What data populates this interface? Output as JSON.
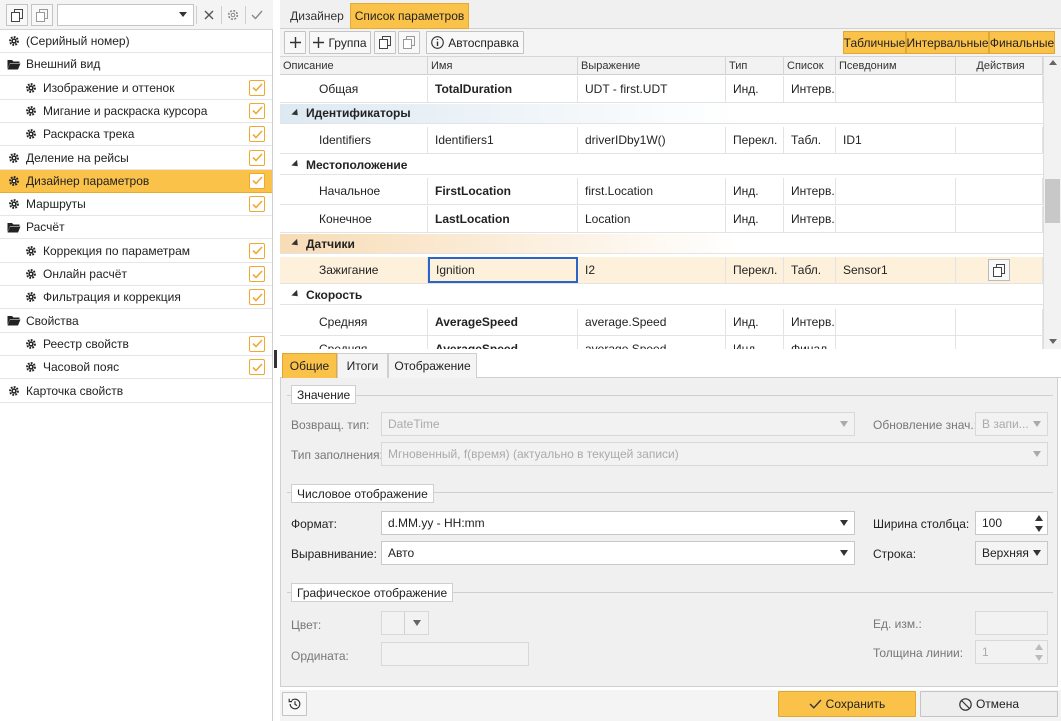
{
  "left_panel": {
    "tree": [
      {
        "label": "(Серийный номер)",
        "icon": "gear-icon",
        "level": 0,
        "checked": false
      },
      {
        "label": "Внешний вид",
        "icon": "folder-open-icon",
        "level": 0,
        "checked": false
      },
      {
        "label": "Изображение и оттенок",
        "icon": "gear-icon",
        "level": 1,
        "checked": true
      },
      {
        "label": "Мигание и раскраска курсора",
        "icon": "gear-icon",
        "level": 1,
        "checked": true
      },
      {
        "label": "Раскраска трека",
        "icon": "gear-icon",
        "level": 1,
        "checked": true
      },
      {
        "label": "Деление на рейсы",
        "icon": "gear-icon",
        "level": 0,
        "checked": true
      },
      {
        "label": "Дизайнер параметров",
        "icon": "gear-icon",
        "level": 0,
        "checked": true,
        "selected": true
      },
      {
        "label": "Маршруты",
        "icon": "gear-icon",
        "level": 0,
        "checked": true
      },
      {
        "label": "Расчёт",
        "icon": "folder-open-icon",
        "level": 0,
        "checked": false
      },
      {
        "label": "Коррекция по параметрам",
        "icon": "gear-icon",
        "level": 1,
        "checked": true
      },
      {
        "label": "Онлайн расчёт",
        "icon": "gear-icon",
        "level": 1,
        "checked": true
      },
      {
        "label": "Фильтрация и коррекция",
        "icon": "gear-icon",
        "level": 1,
        "checked": true
      },
      {
        "label": "Свойства",
        "icon": "folder-open-icon",
        "level": 0,
        "checked": false
      },
      {
        "label": "Реестр свойств",
        "icon": "gear-icon",
        "level": 1,
        "checked": true
      },
      {
        "label": "Часовой пояс",
        "icon": "gear-icon",
        "level": 1,
        "checked": true
      },
      {
        "label": "Карточка свойств",
        "icon": "gear-icon",
        "level": 0,
        "checked": false
      }
    ]
  },
  "tabs": {
    "designer": "Дизайнер",
    "param_list": "Список параметров"
  },
  "toolbar": {
    "group": "Группа",
    "autohelp": "Автосправка",
    "view_table": "Табличные",
    "view_interval": "Интервальные",
    "view_final": "Финальные"
  },
  "grid": {
    "columns": [
      "Описание",
      "Имя",
      "Выражение",
      "Тип",
      "Список",
      "Псевдоним",
      "Действия"
    ],
    "rows": [
      {
        "kind": "row",
        "desc": "Общая",
        "name": "TotalDuration",
        "expr": "UDT - first.UDT",
        "type": "Инд.",
        "list": "Интерв.",
        "alias": ""
      },
      {
        "kind": "group",
        "label": "Идентификаторы"
      },
      {
        "kind": "row",
        "desc": "Identifiers",
        "name": "Identifiers1",
        "expr": "driverIDby1W()",
        "type": "Перекл.",
        "list": "Табл.",
        "alias": "ID1"
      },
      {
        "kind": "group",
        "label": "Местоположение"
      },
      {
        "kind": "row",
        "desc": "Начальное",
        "name": "FirstLocation",
        "expr": "first.Location",
        "type": "Инд.",
        "list": "Интерв.",
        "alias": ""
      },
      {
        "kind": "row",
        "desc": "Конечное",
        "name": "LastLocation",
        "expr": "Location",
        "type": "Инд.",
        "list": "Интерв.",
        "alias": ""
      },
      {
        "kind": "group",
        "label": "Датчики"
      },
      {
        "kind": "row",
        "desc": "Зажигание",
        "name": "Ignition",
        "expr": "I2",
        "type": "Перекл.",
        "list": "Табл.",
        "alias": "Sensor1",
        "selected": true
      },
      {
        "kind": "group",
        "label": "Скорость"
      },
      {
        "kind": "row",
        "desc": "Средняя",
        "name": "AverageSpeed",
        "expr": "average.Speed",
        "type": "Инд.",
        "list": "Интерв.",
        "alias": ""
      },
      {
        "kind": "row",
        "desc": "Средняя",
        "name": "AverageSpeed",
        "expr": "average.Speed",
        "type": "Инд.",
        "list": "Финал.",
        "alias": ""
      }
    ]
  },
  "lower_tabs": {
    "general": "Общие",
    "totals": "Итоги",
    "display": "Отображение"
  },
  "value_section": {
    "title": "Значение",
    "return_type_label": "Возвращ. тип:",
    "return_type_value": "DateTime",
    "update_label": "Обновление знач.:",
    "update_value": "В запи...",
    "fill_label": "Тип заполнения:",
    "fill_value": "Мгновенный, f(время) (актуально в текущей записи)"
  },
  "numeric_section": {
    "title": "Числовое отображение",
    "format_label": "Формат:",
    "format_value": "d.MM.yy - HH:mm",
    "col_width_label": "Ширина столбца:",
    "col_width_value": "100",
    "align_label": "Выравнивание:",
    "align_value": "Авто",
    "row_label": "Строка:",
    "row_value": "Верхняя"
  },
  "graphic_section": {
    "title": "Графическое отображение",
    "color_label": "Цвет:",
    "ordinate_label": "Ордината:",
    "unit_label": "Ед. изм.:",
    "unit_value": "",
    "line_width_label": "Толщина линии:",
    "line_width_value": "1"
  },
  "footer": {
    "save": "Сохранить",
    "cancel": "Отмена"
  },
  "colors": {
    "accent": "#fbc24a",
    "selected_cell_border": "#2a64c8"
  }
}
